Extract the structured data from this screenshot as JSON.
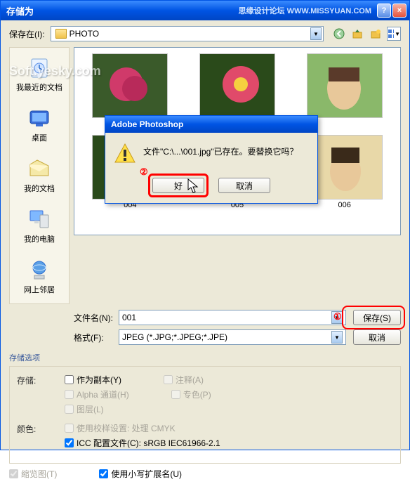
{
  "titlebar": {
    "title": "存储为",
    "brand": "思缘设计论坛  WWW.MISSYUAN.COM",
    "help": "?",
    "close": "×"
  },
  "toprow": {
    "label": "保存在(I):",
    "folder": "PHOTO"
  },
  "places": {
    "recent": "我最近的文档",
    "desktop": "桌面",
    "mydocs": "我的文档",
    "mycomputer": "我的电脑",
    "network": "网上邻居"
  },
  "thumbs": {
    "labels": [
      "004",
      "005",
      "006"
    ]
  },
  "fields": {
    "filename_label": "文件名(N):",
    "filename_value": "001",
    "format_label": "格式(F):",
    "format_value": "JPEG (*.JPG;*.JPEG;*.JPE)",
    "save_btn": "保存(S)",
    "cancel_btn": "取消"
  },
  "annotations": {
    "save_num": "①",
    "ok_num": "②"
  },
  "options": {
    "title": "存储选项",
    "save_label": "存储:",
    "as_copy": "作为副本(Y)",
    "annotations": "注释(A)",
    "alpha": "Alpha 通道(H)",
    "spot": "专色(P)",
    "layers": "图层(L)",
    "color_label": "颜色:",
    "proof": "使用校样设置: 处理 CMYK",
    "icc": "ICC 配置文件(C): sRGB IEC61966-2.1",
    "thumb": "缩览图(T)",
    "lowercase_ext": "使用小写扩展名(U)"
  },
  "dialog": {
    "title": "Adobe Photoshop",
    "message": "文件\"C:\\...\\001.jpg\"已存在。要替换它吗？",
    "ok": "好",
    "cancel": "取消"
  },
  "watermark": "Soft.yesky.com"
}
